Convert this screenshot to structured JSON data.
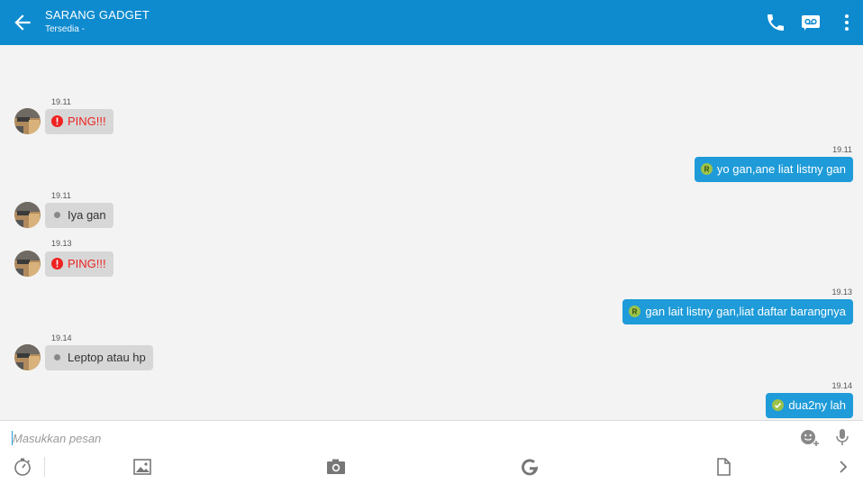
{
  "header": {
    "back_icon": "arrow-left-icon",
    "title": "SARANG GADGET",
    "subtitle": "Tersedia -",
    "actions": [
      "phone-icon",
      "voicemail-icon",
      "more-vertical-icon"
    ],
    "color": "#0e8bcf"
  },
  "messages": [
    {
      "direction": "in",
      "time": "19.11",
      "text": "PING!!!",
      "marker": "ping-alert-icon"
    },
    {
      "direction": "out",
      "time": "19.11",
      "text": "yo gan,ane liat listny gan",
      "marker": "read-r-icon"
    },
    {
      "direction": "in",
      "time": "19.11",
      "text": "Iya gan",
      "marker": "dot-icon"
    },
    {
      "direction": "in",
      "time": "19.13",
      "text": "PING!!!",
      "marker": "ping-alert-icon"
    },
    {
      "direction": "out",
      "time": "19.13",
      "text": "gan lait listny gan,liat daftar barangnya",
      "marker": "read-r-icon"
    },
    {
      "direction": "in",
      "time": "19.14",
      "text": "Leptop atau hp",
      "marker": "dot-icon"
    },
    {
      "direction": "out",
      "time": "19.14",
      "text": "dua2ny lah",
      "marker": "delivered-check-icon"
    }
  ],
  "composer": {
    "placeholder": "Masukkan pesan",
    "value": "",
    "right_icons": [
      "emoji-add-icon",
      "microphone-icon"
    ]
  },
  "toolbar_icons": [
    "timer-icon",
    "gallery-icon",
    "camera-icon",
    "google-icon",
    "file-icon",
    "chevron-right-icon"
  ],
  "colors": {
    "incoming_bubble": "#d7d7d7",
    "outgoing_bubble": "#1e9bd8",
    "ping_text": "#ee2222",
    "background": "#f3f3f3"
  }
}
